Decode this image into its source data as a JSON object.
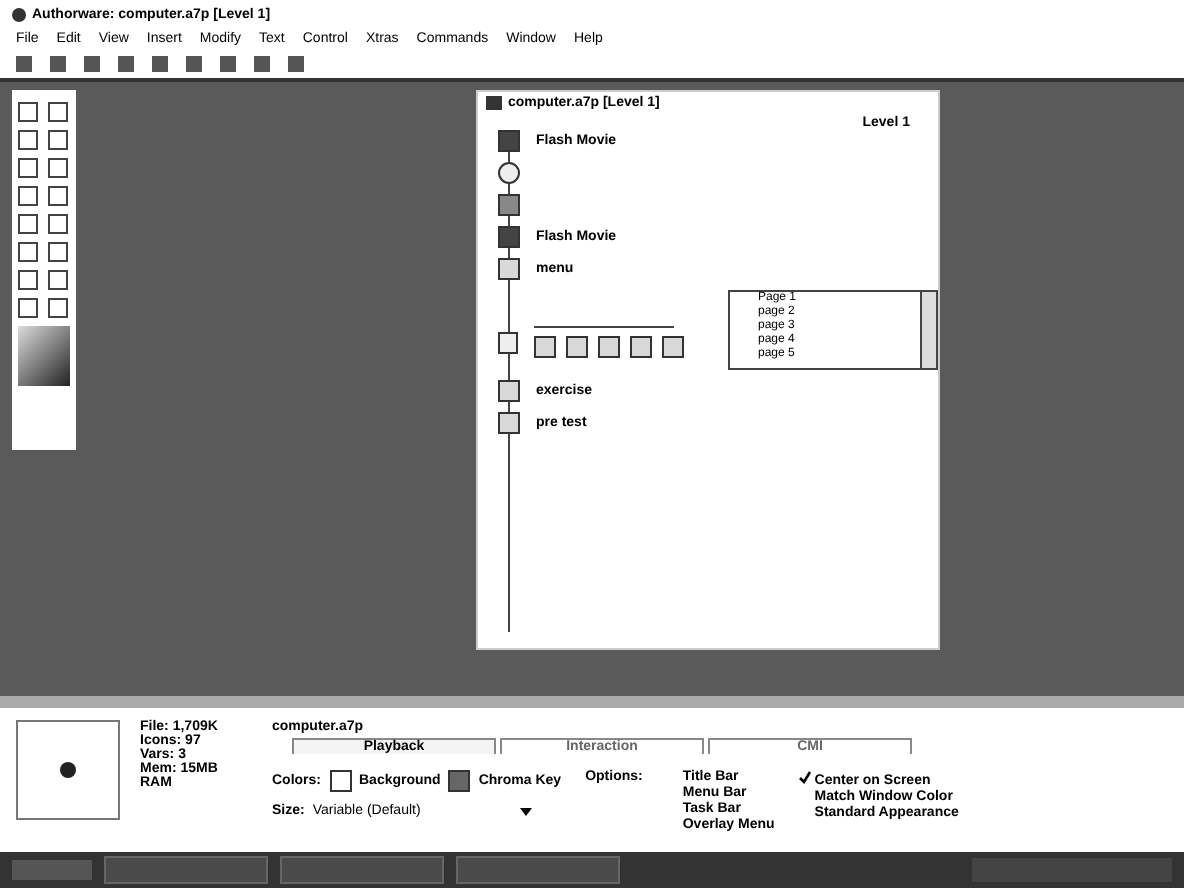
{
  "window": {
    "title": "Authorware: computer.a7p [Level 1]"
  },
  "menu": [
    "File",
    "Edit",
    "View",
    "Insert",
    "Modify",
    "Text",
    "Control",
    "Xtras",
    "Commands",
    "Window",
    "Help"
  ],
  "flowline": {
    "title": "computer.a7p [Level 1]",
    "level": "Level 1",
    "icons": [
      {
        "kind": "movie",
        "label": "Flash Movie"
      },
      {
        "kind": "erase"
      },
      {
        "kind": "display"
      },
      {
        "kind": "movie",
        "label": "Flash Movie"
      },
      {
        "kind": "map",
        "label": "menu"
      },
      {
        "kind": "branch",
        "children": [
          {
            "kind": "map"
          },
          {
            "kind": "map"
          },
          {
            "kind": "map"
          },
          {
            "kind": "map"
          },
          {
            "kind": "map"
          }
        ]
      },
      {
        "kind": "map",
        "label": "exercise"
      },
      {
        "kind": "map",
        "label": "pre test"
      }
    ],
    "pages": [
      {
        "label": "Page 1",
        "selected": false
      },
      {
        "label": "page 2",
        "selected": false
      },
      {
        "label": "page 3",
        "selected": false
      },
      {
        "label": "page 4",
        "selected": false
      },
      {
        "label": "page 5",
        "selected": false
      }
    ]
  },
  "properties": {
    "info": [
      "File: 1,709K",
      "Icons: 97",
      "Vars: 3",
      "Mem: 15MB RAM"
    ],
    "file_name": "computer.a7p",
    "tabs": [
      {
        "label": "Playback",
        "selected": true
      },
      {
        "label": "Interaction",
        "selected": false
      },
      {
        "label": "CMI",
        "selected": false
      }
    ],
    "colors_label": "Colors:",
    "background": "Background",
    "chroma": "Chroma Key",
    "size_label": "Size:",
    "size_value": "Variable (Default)",
    "options_label": "Options:",
    "options": [
      {
        "label": "Title Bar",
        "checked": false
      },
      {
        "label": "Menu Bar",
        "checked": false
      },
      {
        "label": "Task Bar",
        "checked": false
      },
      {
        "label": "Overlay Menu",
        "checked": false
      }
    ],
    "options2": [
      {
        "label": "Center on Screen",
        "checked": true
      },
      {
        "label": "Match Window Color",
        "checked": false
      },
      {
        "label": "Standard Appearance",
        "checked": false
      }
    ]
  }
}
